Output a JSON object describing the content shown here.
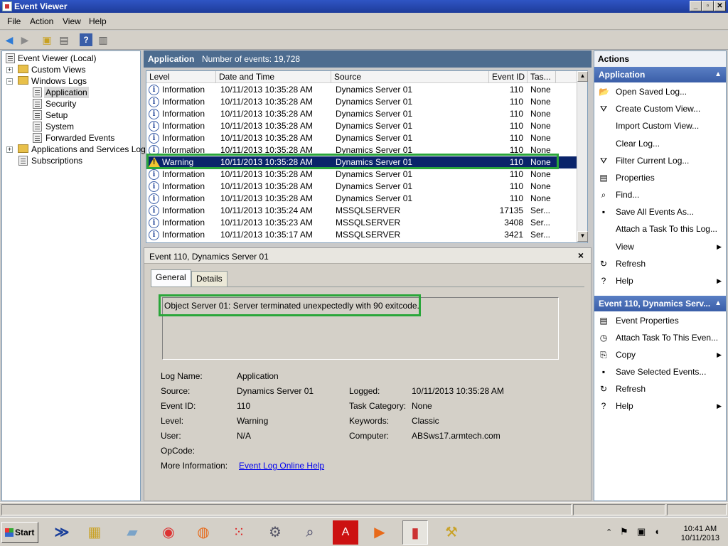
{
  "window": {
    "title": "Event Viewer"
  },
  "menu": [
    "File",
    "Action",
    "View",
    "Help"
  ],
  "tree": {
    "root": "Event Viewer (Local)",
    "custom_views": "Custom Views",
    "windows_logs": "Windows Logs",
    "logs": [
      "Application",
      "Security",
      "Setup",
      "System",
      "Forwarded Events"
    ],
    "apps_services": "Applications and Services Logs",
    "subscriptions": "Subscriptions"
  },
  "center": {
    "log_name": "Application",
    "event_count": "Number of events: 19,728"
  },
  "grid": {
    "columns": [
      "Level",
      "Date and Time",
      "Source",
      "Event ID",
      "Tas..."
    ],
    "rows": [
      {
        "level": "Information",
        "date": "10/11/2013 10:35:28 AM",
        "source": "Dynamics Server 01",
        "id": "110",
        "task": "None"
      },
      {
        "level": "Information",
        "date": "10/11/2013 10:35:28 AM",
        "source": "Dynamics Server 01",
        "id": "110",
        "task": "None"
      },
      {
        "level": "Information",
        "date": "10/11/2013 10:35:28 AM",
        "source": "Dynamics Server 01",
        "id": "110",
        "task": "None"
      },
      {
        "level": "Information",
        "date": "10/11/2013 10:35:28 AM",
        "source": "Dynamics Server 01",
        "id": "110",
        "task": "None"
      },
      {
        "level": "Information",
        "date": "10/11/2013 10:35:28 AM",
        "source": "Dynamics Server 01",
        "id": "110",
        "task": "None"
      },
      {
        "level": "Information",
        "date": "10/11/2013 10:35:28 AM",
        "source": "Dynamics Server 01",
        "id": "110",
        "task": "None"
      },
      {
        "level": "Warning",
        "date": "10/11/2013 10:35:28 AM",
        "source": "Dynamics Server 01",
        "id": "110",
        "task": "None"
      },
      {
        "level": "Information",
        "date": "10/11/2013 10:35:28 AM",
        "source": "Dynamics Server 01",
        "id": "110",
        "task": "None"
      },
      {
        "level": "Information",
        "date": "10/11/2013 10:35:28 AM",
        "source": "Dynamics Server 01",
        "id": "110",
        "task": "None"
      },
      {
        "level": "Information",
        "date": "10/11/2013 10:35:28 AM",
        "source": "Dynamics Server 01",
        "id": "110",
        "task": "None"
      },
      {
        "level": "Information",
        "date": "10/11/2013 10:35:24 AM",
        "source": "MSSQLSERVER",
        "id": "17135",
        "task": "Ser..."
      },
      {
        "level": "Information",
        "date": "10/11/2013 10:35:23 AM",
        "source": "MSSQLSERVER",
        "id": "3408",
        "task": "Ser..."
      },
      {
        "level": "Information",
        "date": "10/11/2013 10:35:17 AM",
        "source": "MSSQLSERVER",
        "id": "3421",
        "task": "Ser..."
      }
    ]
  },
  "detail": {
    "header": "Event 110, Dynamics Server 01",
    "tabs": [
      "General",
      "Details"
    ],
    "message": "Object Server 01:  Server terminated unexpectedly with 90 exitcode.",
    "fields": {
      "log_name_label": "Log Name:",
      "log_name": "Application",
      "source_label": "Source:",
      "source": "Dynamics Server 01",
      "logged_label": "Logged:",
      "logged": "10/11/2013 10:35:28 AM",
      "event_id_label": "Event ID:",
      "event_id": "110",
      "task_label": "Task Category:",
      "task": "None",
      "level_label": "Level:",
      "level": "Warning",
      "keywords_label": "Keywords:",
      "keywords": "Classic",
      "user_label": "User:",
      "user": "N/A",
      "computer_label": "Computer:",
      "computer": "ABSws17.armtech.com",
      "opcode_label": "OpCode:",
      "more_info_label": "More Information:",
      "more_info_link": "Event Log Online Help"
    }
  },
  "actions": {
    "header": "Actions",
    "section1": "Application",
    "items1": [
      "Open Saved Log...",
      "Create Custom View...",
      "Import Custom View...",
      "Clear Log...",
      "Filter Current Log...",
      "Properties",
      "Find...",
      "Save All Events As...",
      "Attach a Task To this Log...",
      "View",
      "Refresh",
      "Help"
    ],
    "section2": "Event 110, Dynamics Serv...",
    "items2": [
      "Event Properties",
      "Attach Task To This Even...",
      "Copy",
      "Save Selected Events...",
      "Refresh",
      "Help"
    ]
  },
  "taskbar": {
    "start": "Start",
    "time": "10:41 AM",
    "date": "10/11/2013"
  },
  "colors": {
    "titlebar": "#2f55c4",
    "selection": "#0a246a",
    "highlight_box": "#2aa63a",
    "section": "#3a5ea8"
  }
}
